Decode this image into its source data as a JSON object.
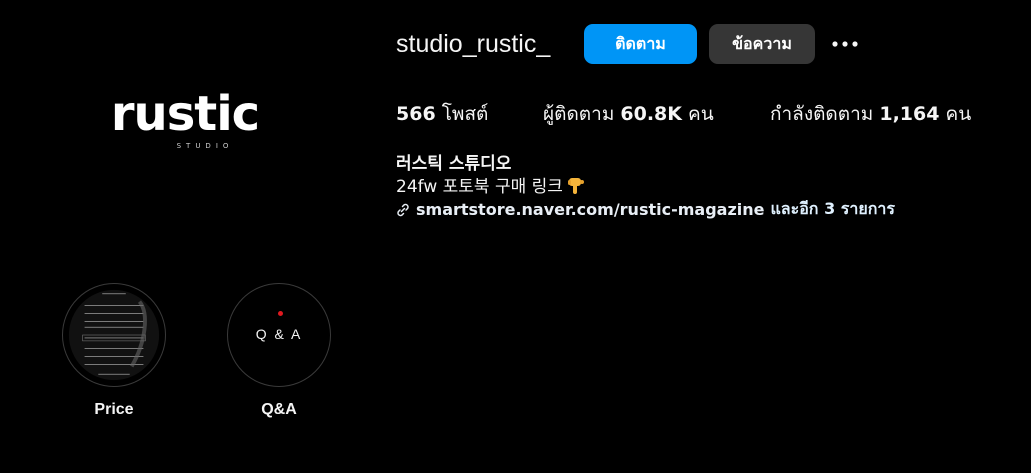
{
  "profile": {
    "logo_word": "rustic",
    "logo_sub": "STUDIO",
    "username": "studio_rustic_"
  },
  "actions": {
    "follow_label": "ติดตาม",
    "message_label": "ข้อความ",
    "more_icon": "more-horizontal-icon"
  },
  "stats": {
    "posts_value": "566",
    "posts_label": "โพสต์",
    "followers_label_before": "ผู้ติดตาม",
    "followers_value": "60.8K",
    "followers_unit": "คน",
    "following_label_before": "กำลังติดตาม",
    "following_value": "1,164",
    "following_unit": "คน"
  },
  "bio": {
    "name": "러스틱 스튜디오",
    "text": "24fw 포토북 구매 링크",
    "emoji_icon": "pointing-down-hand-icon",
    "link_icon": "link-icon",
    "link_text": "smartstore.naver.com/rustic-magazine",
    "link_more": "และอีก 3 รายการ"
  },
  "highlights": [
    {
      "label": "Price"
    },
    {
      "label": "Q&A",
      "cover_text": "Q & A"
    }
  ],
  "colors": {
    "accent": "#0095f6",
    "secondary_button": "#363636",
    "background": "#000000",
    "qa_dot": "#e0191f"
  }
}
